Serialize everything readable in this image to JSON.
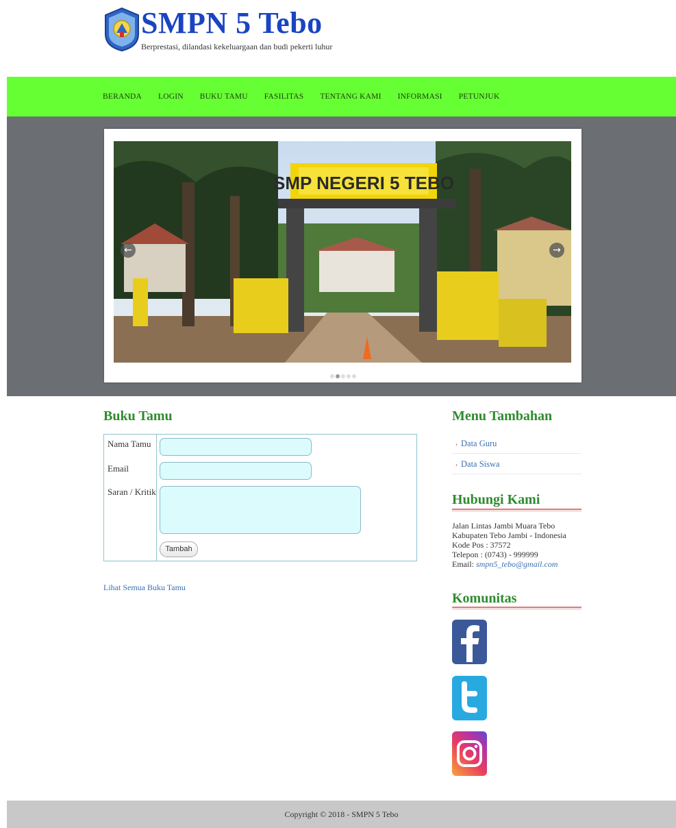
{
  "site": {
    "title": "SMPN 5 Tebo",
    "tagline": "Berprestasi, dilandasi kekeluargaan dan budi pekerti luhur"
  },
  "nav": {
    "items": [
      "BERANDA",
      "LOGIN",
      "BUKU TAMU",
      "FASILITAS",
      "TENTANG KAMI",
      "INFORMASI",
      "PETUNJUK"
    ]
  },
  "slider": {
    "sign_text": "SMP NEGERI 5 TEBO",
    "prev_icon": "arrow-left-icon",
    "next_icon": "arrow-right-icon",
    "slide_count": 5,
    "active_slide": 2
  },
  "guestbook": {
    "title": "Buku Tamu",
    "name_label": "Nama Tamu",
    "email_label": "Email",
    "message_label": "Saran / Kritik",
    "name_value": "",
    "email_value": "",
    "message_value": "",
    "submit_label": "Tambah",
    "view_all_label": "Lihat Semua Buku Tamu"
  },
  "sidebar": {
    "menu_title": "Menu Tambahan",
    "menu_items": [
      "Data Guru",
      "Data Siswa"
    ],
    "contact_title": "Hubungi Kami",
    "address_line1": "Jalan Lintas Jambi Muara Tebo",
    "address_line2": "Kabupaten Tebo Jambi - Indonesia",
    "postal": "Kode Pos : 37572",
    "phone": "Telepon : (0743) - 999999",
    "email_label": "Email: ",
    "email_value": "smpn5_tebo@gmail.com",
    "community_title": "Komunitas",
    "social_icons": [
      "facebook-icon",
      "twitter-icon",
      "instagram-icon"
    ]
  },
  "footer": {
    "copyright": "Copyright © 2018 - SMPN 5 Tebo"
  },
  "colors": {
    "nav_bg": "#66ff33",
    "title_blue": "#1a44c2",
    "section_green": "#2e8b2e",
    "slider_band": "#6b6f74",
    "input_bg": "#dbfbfd",
    "footer_bg": "#c8c8c8"
  }
}
